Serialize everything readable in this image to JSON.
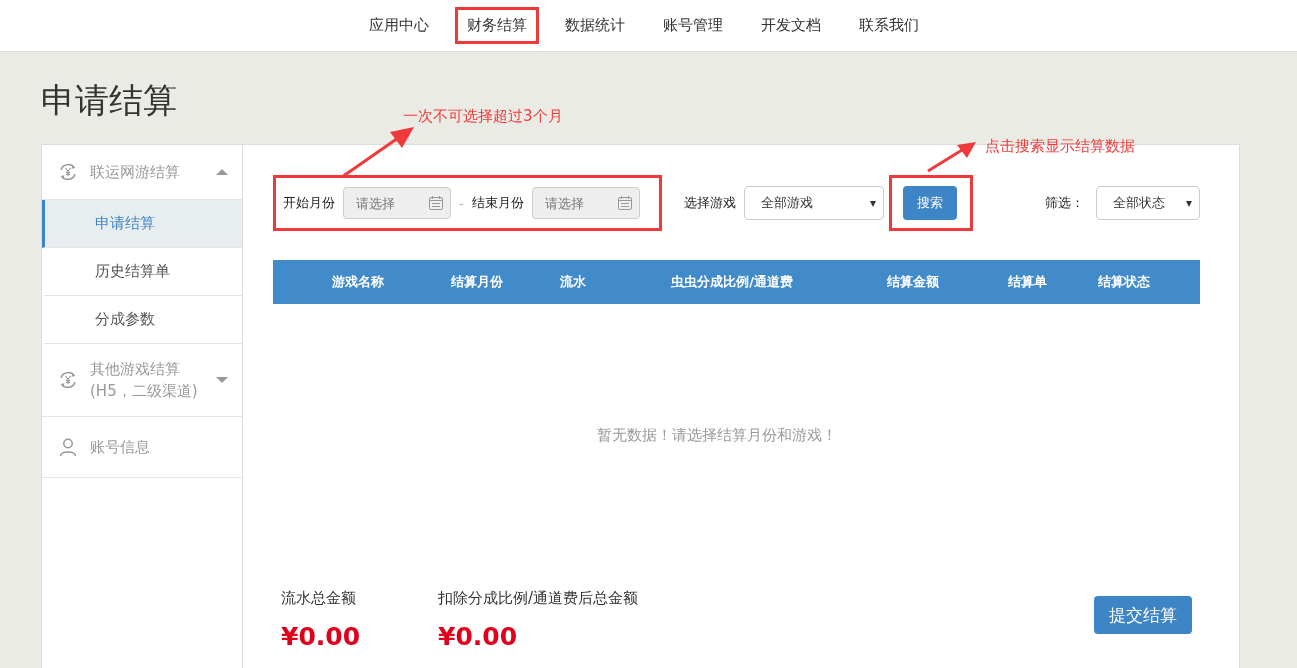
{
  "nav": [
    {
      "label": "应用中心",
      "annotated": false
    },
    {
      "label": "财务结算",
      "annotated": true
    },
    {
      "label": "数据统计",
      "annotated": false
    },
    {
      "label": "账号管理",
      "annotated": false
    },
    {
      "label": "开发文档",
      "annotated": false
    },
    {
      "label": "联系我们",
      "annotated": false
    }
  ],
  "page_title": "申请结算",
  "sidebar": [
    {
      "kind": "group",
      "label": "联运网游结算",
      "expanded": true,
      "children": [
        {
          "label": "申请结算",
          "selected": true
        },
        {
          "label": "历史结算单",
          "selected": false
        },
        {
          "label": "分成参数",
          "selected": false
        }
      ]
    },
    {
      "kind": "group",
      "label": "其他游戏结算",
      "sublabel": "(H5，二级渠道)",
      "expanded": false
    },
    {
      "kind": "user",
      "label": "账号信息"
    }
  ],
  "filters": {
    "start_label": "开始月份",
    "start": {
      "placeholder": "请选择"
    },
    "separator": "-",
    "end_label": "结束月份",
    "end": {
      "placeholder": "请选择"
    },
    "game_label": "选择游戏",
    "game_value": "全部游戏",
    "search_button": "搜索",
    "status_label": "筛选：",
    "status_value": "全部状态"
  },
  "annotations": [
    {
      "text": "一次不可选择超过3个月"
    },
    {
      "text": "点击搜索显示结算数据"
    }
  ],
  "table": {
    "columns": [
      "游戏名称",
      "结算月份",
      "流水",
      "虫虫分成比例/通道费",
      "结算金额",
      "结算单",
      "结算状态"
    ],
    "empty_message": "暂无数据！请选择结算月份和游戏！"
  },
  "summary": [
    {
      "label": "流水总金额",
      "value": "¥0.00"
    },
    {
      "label": "扣除分成比例/通道费后总金额",
      "value": "¥0.00"
    }
  ],
  "submit_button": "提交结算"
}
